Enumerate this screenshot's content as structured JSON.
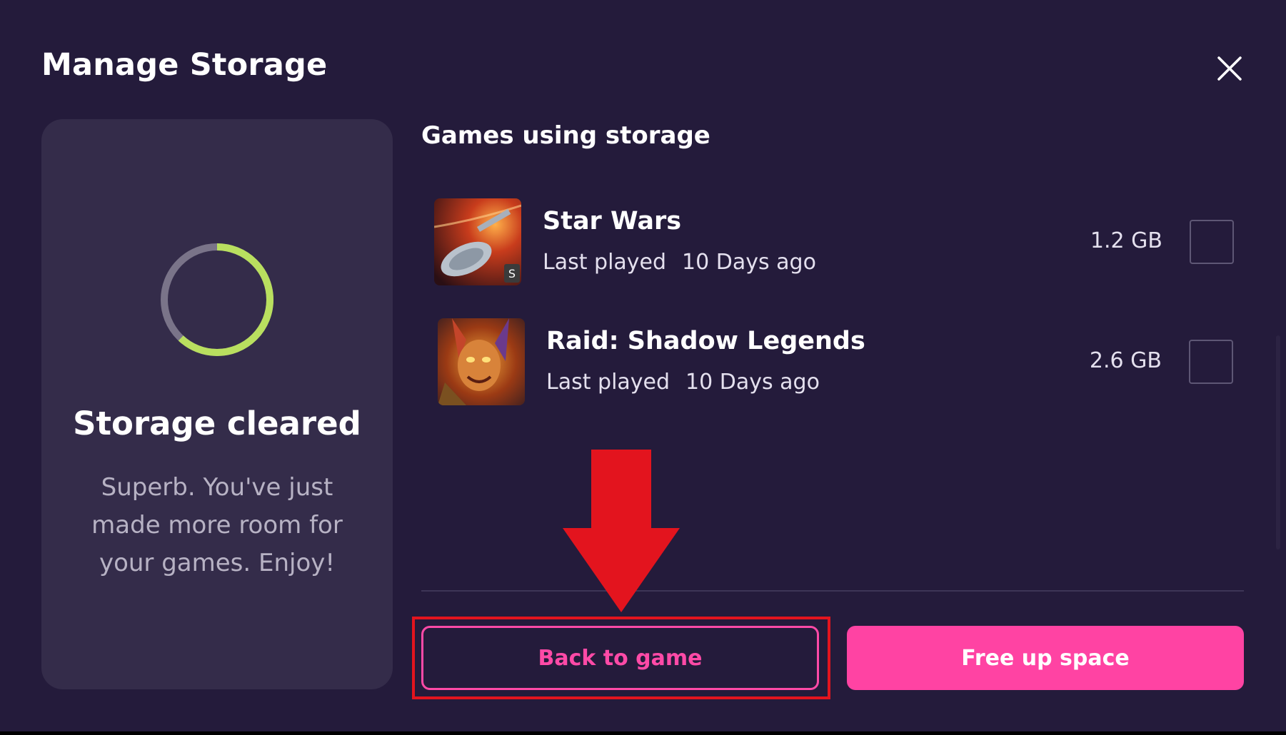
{
  "modal": {
    "title": "Manage Storage",
    "close_icon": "close-icon"
  },
  "status_card": {
    "title": "Storage cleared",
    "description": "Superb. You've just made more room for your games. Enjoy!",
    "ring_progress": 0.62,
    "ring_color": "#b9df5f",
    "ring_track_color": "#7a7489"
  },
  "games_section": {
    "title": "Games using storage",
    "games": [
      {
        "name": "Star Wars",
        "last_played_label": "Last played",
        "last_played_value": "10 Days ago",
        "size": "1.2 GB",
        "checked": false
      },
      {
        "name": "Raid: Shadow Legends",
        "last_played_label": "Last played",
        "last_played_value": "10 Days ago",
        "size": "2.6 GB",
        "checked": false
      }
    ]
  },
  "actions": {
    "back_label": "Back to game",
    "free_label": "Free up space"
  },
  "colors": {
    "accent": "#ff43a3",
    "highlight": "#e3141e",
    "background": "#241b3b"
  }
}
